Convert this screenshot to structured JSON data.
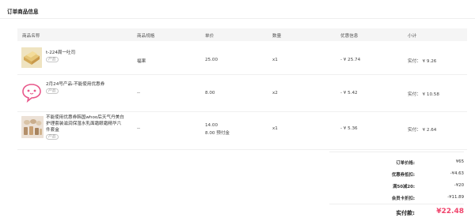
{
  "section": {
    "title": "订单商品信息"
  },
  "columns": {
    "product_name": "商品名称",
    "spec": "商品规格",
    "unit_price": "单价",
    "quantity": "数量",
    "discount": "优惠信息",
    "subtotal": "小计"
  },
  "items": [
    {
      "name": "t-224周一吐司",
      "tag": "产品",
      "thumb_icon": "toast-bread-image",
      "spec": "福果",
      "price": "25.00",
      "price_note": "",
      "qty": "x1",
      "discount": "- ¥ 25.74",
      "subtotal": "实付：  ¥ 9.26"
    },
    {
      "name": "2月24号产品-不能使用优惠券",
      "tag": "产品",
      "thumb_icon": "placeholder-face-image",
      "spec": "--",
      "price": "8.00",
      "price_note": "",
      "qty": "x2",
      "discount": "- ¥ 5.42",
      "subtotal": "实付：  ¥ 10.58"
    },
    {
      "name_lines": [
        "不能使用优惠券韩国whoo后天气丹美白",
        "护理套装滋润保湿水乳面霜眼霜精华六",
        "件套盒"
      ],
      "tag": "产品",
      "thumb_icon": "cosmetics-set-image",
      "spec": "--",
      "price": "14.00",
      "price_note": "8.00 预付金",
      "qty": "x1",
      "discount": "- ¥ 5.36",
      "subtotal": "实付：  ¥ 2.64"
    }
  ],
  "summary": {
    "order_price_label": "订单价格:",
    "order_price": "¥65",
    "coupon_label": "优惠券抵扣:",
    "coupon": "-¥4.63",
    "full_reduce_label": "满50减20:",
    "full_reduce": "-¥20",
    "member_label": "会员卡折扣:",
    "member": "-¥11.89",
    "paid_label": "实付款:",
    "paid": "¥22.48"
  },
  "colors": {
    "accent": "#f0436b",
    "face": "#e8578a"
  }
}
